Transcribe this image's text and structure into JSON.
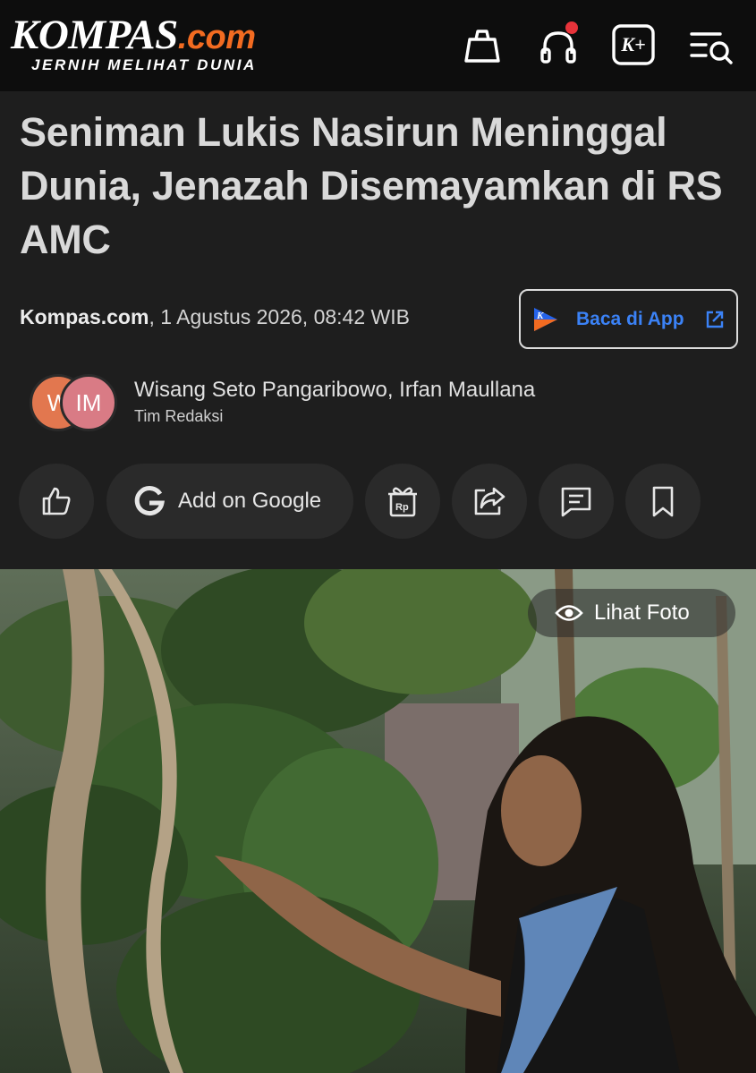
{
  "header": {
    "logo_main": "KOMPAS",
    "logo_suffix": ".com",
    "logo_tagline": "JERNIH MELIHAT DUNIA",
    "icons": [
      "shopping-bag-icon",
      "headphones-icon",
      "kompas-plus-icon",
      "search-menu-icon"
    ],
    "kplus_label": "K+"
  },
  "article": {
    "headline": "Seniman Lukis Nasirun Meninggal Dunia, Jenazah Disemayamkan di RS AMC",
    "source": "Kompas.com",
    "datetime": ", 1 Agustus 2026, 08:42 WIB",
    "app_button_label": "Baca di App",
    "app_logo_letter": "K"
  },
  "authors": {
    "avatar1": "W",
    "avatar2": "IM",
    "names": "Wisang Seto Pangaribowo,  Irfan Maullana",
    "team": "Tim Redaksi"
  },
  "actions": {
    "google_label": "Add on Google",
    "gift_label": "Rp"
  },
  "photo": {
    "view_label": "Lihat Foto"
  },
  "colors": {
    "accent": "#f26b21",
    "link": "#3b82f6",
    "background": "#1e1e1e",
    "topbar": "#0d0d0d",
    "notification": "#e8333a"
  }
}
